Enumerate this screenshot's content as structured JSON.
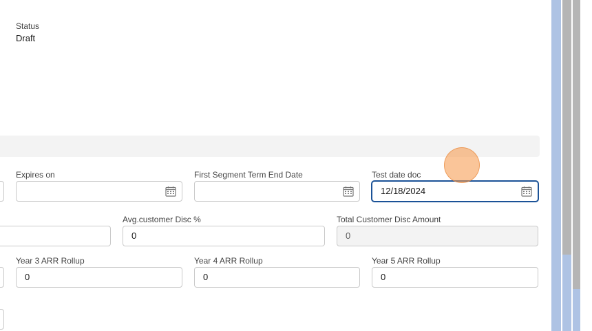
{
  "status": {
    "label": "Status",
    "value": "Draft"
  },
  "fields": {
    "expires_on": {
      "label": "Expires on",
      "value": ""
    },
    "first_segment_term_end_date": {
      "label": "First Segment Term End Date",
      "value": ""
    },
    "test_date_doc": {
      "label": "Test date doc",
      "value": "12/18/2024"
    },
    "avg_customer_disc": {
      "label": "Avg.customer Disc %",
      "value": "0"
    },
    "total_customer_disc_amount": {
      "label": "Total Customer Disc Amount",
      "value": "0"
    },
    "year3_arr_rollup": {
      "label": "Year 3 ARR Rollup",
      "value": "0"
    },
    "year4_arr_rollup": {
      "label": "Year 4 ARR Rollup",
      "value": "0"
    },
    "year5_arr_rollup": {
      "label": "Year 5 ARR Rollup",
      "value": "0"
    }
  },
  "icons": {
    "calendar": "calendar-icon"
  },
  "colors": {
    "focus_border": "#1b5297",
    "scrollbar_track": "#aec3e4",
    "scrollbar_thumb": "#b5b5b5"
  }
}
